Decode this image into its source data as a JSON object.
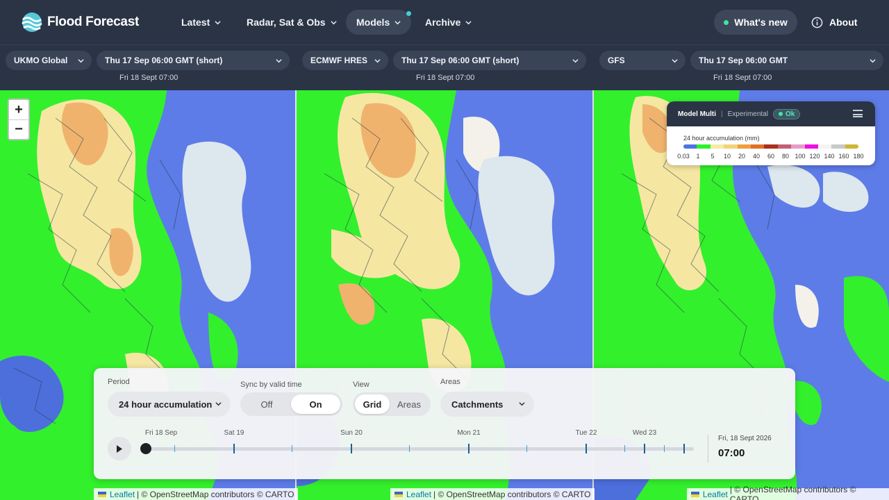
{
  "app": {
    "brand": "Flood Forecast"
  },
  "nav": {
    "latest": "Latest",
    "radar": "Radar, Sat & Obs",
    "models": "Models",
    "archive": "Archive",
    "whats_new": "What's new",
    "about": "About"
  },
  "models": [
    {
      "name": "UKMO Global",
      "run": "Thu 17 Sep 06:00 GMT (short)",
      "valid": "Fri 18 Sept 07:00"
    },
    {
      "name": "ECMWF HRES",
      "run": "Thu 17 Sep 06:00 GMT (short)",
      "valid": "Fri 18 Sept 07:00"
    },
    {
      "name": "GFS",
      "run": "Thu 17 Sep 06:00 GMT",
      "valid": "Fri 18 Sept 07:00"
    }
  ],
  "map": {
    "zoom_in": "+",
    "zoom_out": "−",
    "attribution_leaflet": "Leaflet",
    "attribution_rest": "| © OpenStreetMap contributors © CARTO",
    "colors": {
      "blue": "#5d7ce8",
      "green": "#33f02c",
      "yellow": "#f5e7a2",
      "orange": "#f0b36e",
      "pale": "#f4f1ea",
      "sea": "#dde7ee"
    }
  },
  "legend": {
    "title": "Model Multi",
    "separator": "|",
    "mode": "Experimental",
    "status": "Ok",
    "subtitle": "24 hour accumulation (mm)",
    "colors": [
      "#4f73e3",
      "#2cf12b",
      "#f6eca4",
      "#f3d27c",
      "#f09e3f",
      "#e07226",
      "#a8321c",
      "#c45f73",
      "#e49ec7",
      "#f00fe0",
      "#f4f4f4",
      "#c9c9c9",
      "#cfb634"
    ],
    "ticks": [
      "0.03",
      "1",
      "5",
      "10",
      "20",
      "40",
      "60",
      "80",
      "100",
      "120",
      "140",
      "160",
      "180"
    ]
  },
  "controls": {
    "period_label": "Period",
    "period_value": "24 hour accumulation",
    "sync_label": "Sync by valid time",
    "sync_off": "Off",
    "sync_on": "On",
    "view_label": "View",
    "view_grid": "Grid",
    "view_areas": "Areas",
    "areas_label": "Areas",
    "areas_value": "Catchments",
    "days": [
      "Fri 18 Sep",
      "Sat 19",
      "Sun 20",
      "Mon 21",
      "Tue 22",
      "Wed 23"
    ],
    "current_date": "Fri, 18 Sept 2026",
    "current_time": "07:00"
  }
}
